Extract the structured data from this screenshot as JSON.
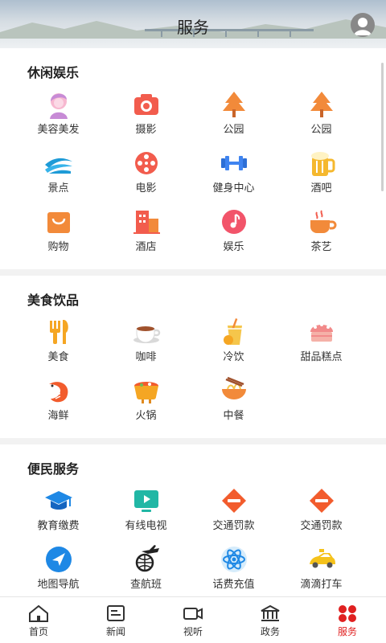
{
  "header": {
    "title": "服务"
  },
  "sections": [
    {
      "title": "休闲娱乐",
      "items": [
        {
          "label": "美容美发",
          "icon": "beauty-icon"
        },
        {
          "label": "摄影",
          "icon": "camera-icon"
        },
        {
          "label": "公园",
          "icon": "tree-icon"
        },
        {
          "label": "公园",
          "icon": "tree-icon"
        },
        {
          "label": "景点",
          "icon": "scenery-icon"
        },
        {
          "label": "电影",
          "icon": "film-reel-icon"
        },
        {
          "label": "健身中心",
          "icon": "dumbbell-icon"
        },
        {
          "label": "酒吧",
          "icon": "beer-icon"
        },
        {
          "label": "购物",
          "icon": "shopping-bag-icon"
        },
        {
          "label": "酒店",
          "icon": "hotel-icon"
        },
        {
          "label": "娱乐",
          "icon": "music-note-icon"
        },
        {
          "label": "茶艺",
          "icon": "tea-cup-icon"
        }
      ]
    },
    {
      "title": "美食饮品",
      "items": [
        {
          "label": "美食",
          "icon": "fork-knife-icon"
        },
        {
          "label": "咖啡",
          "icon": "coffee-icon"
        },
        {
          "label": "冷饮",
          "icon": "cold-drink-icon"
        },
        {
          "label": "甜品糕点",
          "icon": "cake-icon"
        },
        {
          "label": "海鲜",
          "icon": "shrimp-icon"
        },
        {
          "label": "火锅",
          "icon": "hotpot-icon"
        },
        {
          "label": "中餐",
          "icon": "noodle-bowl-icon"
        }
      ]
    },
    {
      "title": "便民服务",
      "items": [
        {
          "label": "教育缴费",
          "icon": "graduation-cap-icon"
        },
        {
          "label": "有线电视",
          "icon": "tv-icon"
        },
        {
          "label": "交通罚款",
          "icon": "no-entry-icon"
        },
        {
          "label": "交通罚款",
          "icon": "no-entry-icon"
        },
        {
          "label": "地图导航",
          "icon": "navigation-icon"
        },
        {
          "label": "查航班",
          "icon": "airplane-globe-icon"
        },
        {
          "label": "话费充值",
          "icon": "atom-icon"
        },
        {
          "label": "滴滴打车",
          "icon": "taxi-icon"
        }
      ]
    }
  ],
  "tabbar": [
    {
      "label": "首页",
      "icon": "home-icon"
    },
    {
      "label": "新闻",
      "icon": "news-icon"
    },
    {
      "label": "视听",
      "icon": "video-camera-icon"
    },
    {
      "label": "政务",
      "icon": "government-icon"
    },
    {
      "label": "服务",
      "icon": "services-icon",
      "active": true
    }
  ],
  "colors": {
    "accent": "#e02020",
    "orange": "#f07a2a",
    "blue": "#1e88e5"
  }
}
